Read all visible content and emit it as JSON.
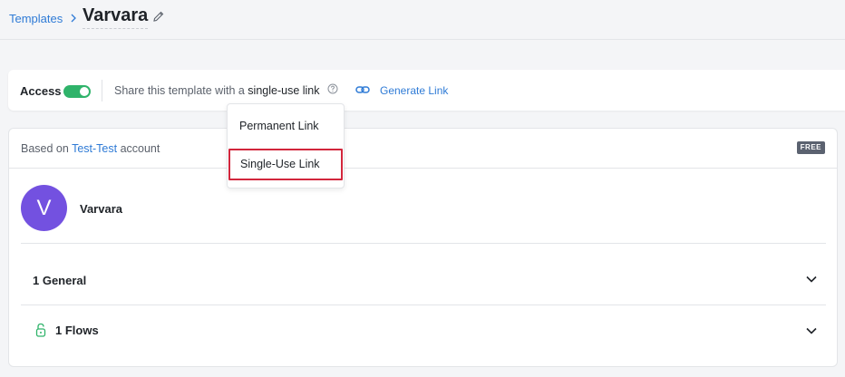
{
  "breadcrumb": {
    "parent": "Templates",
    "title": "Varvara"
  },
  "access": {
    "label": "Access",
    "enabled": true,
    "share_prefix": "Share this template with a ",
    "share_link_type": "single-use link",
    "generate_label": "Generate Link"
  },
  "dropdown": {
    "options": [
      "Permanent Link",
      "Single-Use Link"
    ],
    "highlighted": "Single-Use Link"
  },
  "card": {
    "based_prefix": "Based on ",
    "account": "Test-Test",
    "based_suffix": " account",
    "badge": "FREE",
    "avatar_letter": "V",
    "profile_name": "Varvara",
    "sections": [
      {
        "label": "1 General",
        "icon": ""
      },
      {
        "label": "1 Flows",
        "icon": "lock-icon"
      }
    ]
  },
  "colors": {
    "accent": "#2f7bd6",
    "toggle_on": "#2fb36a",
    "avatar": "#7351e0",
    "highlight_border": "#d2263c",
    "lock": "#2fb36a"
  }
}
